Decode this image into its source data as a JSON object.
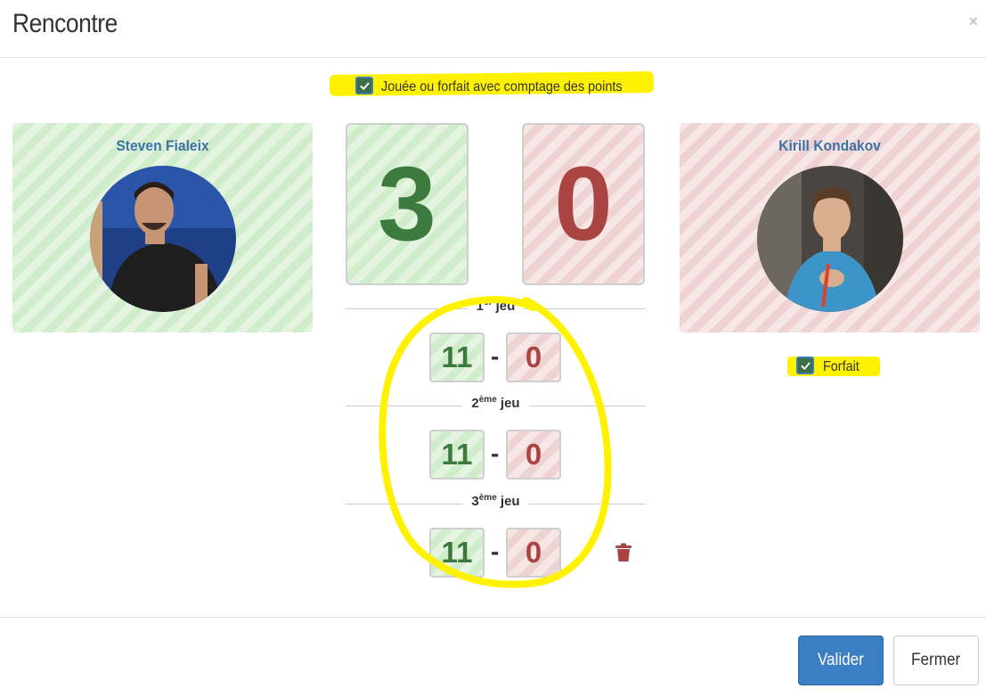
{
  "modal": {
    "title": "Rencontre",
    "close": "×"
  },
  "played_checkbox": {
    "checked": true,
    "label": "Jouée ou forfait avec comptage des points"
  },
  "player1": {
    "name": "Steven Fialeix",
    "score": "3"
  },
  "player2": {
    "name": "Kirill Kondakov",
    "score": "0",
    "forfait_checked": true,
    "forfait_label": "Forfait"
  },
  "games": [
    {
      "num": "1",
      "sup": "er",
      "suffix": " jeu",
      "p1": "11",
      "p2": "0"
    },
    {
      "num": "2",
      "sup": "ème",
      "suffix": " jeu",
      "p1": "11",
      "p2": "0"
    },
    {
      "num": "3",
      "sup": "ème",
      "suffix": " jeu",
      "p1": "11",
      "p2": "0"
    }
  ],
  "dash": "-",
  "footer": {
    "validate_label": "Valider",
    "close_label": "Fermer"
  },
  "colors": {
    "green": "#3d7a3d",
    "red": "#a94442",
    "primary": "#3a7fc4",
    "highlight": "#fff200"
  },
  "icons": {
    "checkbox": "check-icon",
    "delete": "trash-icon",
    "close": "close-icon"
  }
}
